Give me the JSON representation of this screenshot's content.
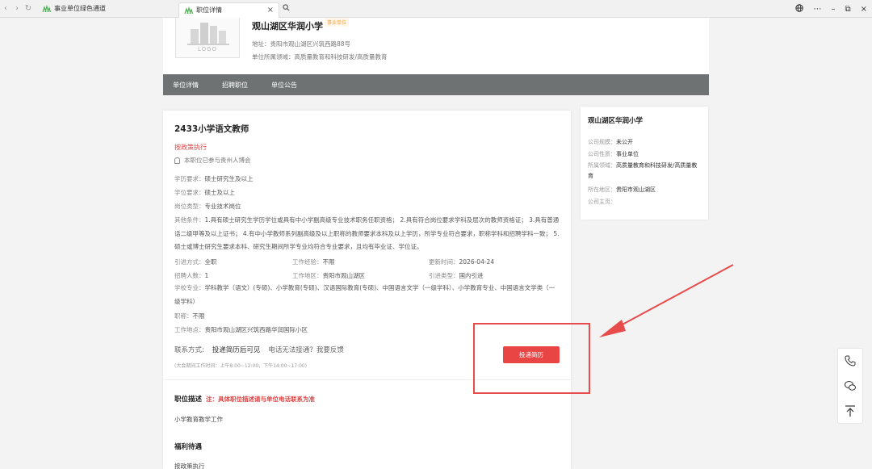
{
  "browser": {
    "tabs": [
      {
        "label": "事业单位绿色通道"
      },
      {
        "label": "职位详情"
      }
    ]
  },
  "company": {
    "logo_text": "LOGO",
    "name": "观山湖区华润小学",
    "tag": "事业单位",
    "address_label": "地址：",
    "address": "贵阳市观山湖区兴筑西路88号",
    "field_label": "单位所属领域：",
    "field": "高质量教育和科技研发/高质量教育"
  },
  "nav": {
    "items": [
      {
        "label": "单位详情"
      },
      {
        "label": "招聘职位"
      },
      {
        "label": "单位公告"
      }
    ]
  },
  "job": {
    "title": "2433小学语文教师",
    "salary": "按政策执行",
    "expo_note": "本职位已参与贵州人博会",
    "edu_label": "学历要求：",
    "edu": "硕士研究生及以上",
    "degree_label": "学位要求：",
    "degree": "硕士及以上",
    "type_label": "岗位类型：",
    "type": "专业技术岗位",
    "other_label": "其他条件：",
    "other": "1.具有硕士研究生学历学位或具有中小学副高级专业技术职务任职资格； 2.具有符合岗位要求学科及层次的教师资格证； 3.具有普通话二级甲等及以上证书； 4.有中小学教师系列副高级及以上职称的教师要求本科及以上学历，所学专业符合要求，职称学科和招聘学科一致； 5.硕士或博士研究生要求本科、研究生期间所学专业均符合专业要求，且均有毕业证、学位证。",
    "intro_method_label": "引进方式：",
    "intro_method": "全职",
    "experience_label": "工作经验：",
    "experience": "不限",
    "updated_label": "更新时间：",
    "updated": "2026-04-24",
    "headcount_label": "招聘人数：",
    "headcount": "1",
    "region_label": "工作地区：",
    "region": "贵阳市观山湖区",
    "intro_type_label": "引进类型：",
    "intro_type": "国内引进",
    "major_label": "学校专业：",
    "major": "学科教学（语文）(专硕)、小学教育(专硕)、汉语国际教育(专硕)、中国语言文学（一级学科）、小学教育专业、中国语言文学类（一级学科）",
    "title_req_label": "职称：",
    "title_req": "不限",
    "location_label": "工作地点：",
    "location": "贵阳市观山湖区兴筑西路华润国际小区",
    "contact_label": "联系方式:",
    "contact_value": "投递简历后可见",
    "phone_issue": "电话无法接通？我要反馈",
    "hours": "(大会期间工作时间：上午8:00~12:00，下午14:00~17:00)",
    "apply_label": "投递简历",
    "desc_title": "职位描述",
    "desc_note": "注：具体职位描述请与单位电话联系为准",
    "desc_body": "小学教育教学工作",
    "benefits_title": "福利待遇",
    "benefits_body": "按政策执行"
  },
  "side": {
    "name": "观山湖区华润小学",
    "scale_label": "公司规模：",
    "scale": "未公开",
    "nature_label": "公司性质：",
    "nature": "事业单位",
    "field_label": "所属领域：",
    "field": "高质量教育和科技研发/高质量教育",
    "area_label": "所在地区：",
    "area": "贵阳市观山湖区",
    "home_label": "公司主页："
  },
  "colors": {
    "accent_red": "#e94545",
    "nav_gray": "#6f7273",
    "annotation_red": "#e84b4b"
  },
  "icons": [
    "back-icon",
    "forward-icon",
    "refresh-icon",
    "search-icon",
    "globe-icon",
    "more-icon",
    "minimize-icon",
    "restore-icon",
    "close-icon",
    "bell-icon",
    "phone-icon",
    "wechat-icon",
    "back-to-top-icon"
  ]
}
